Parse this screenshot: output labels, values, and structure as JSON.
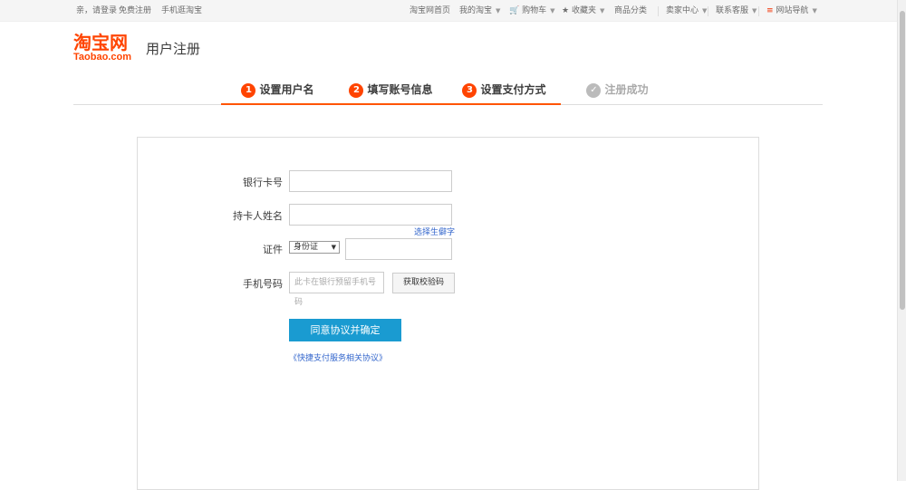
{
  "topbar": {
    "greeting": "亲，请登录",
    "register": "免费注册",
    "mobile": "手机逛淘宝",
    "home": "淘宝网首页",
    "my_taobao": "我的淘宝",
    "cart": "购物车",
    "favorites": "收藏夹",
    "categories": "商品分类",
    "seller_center": "卖家中心",
    "contact": "联系客服",
    "site_nav": "网站导航"
  },
  "header": {
    "logo_cn": "淘宝网",
    "logo_en": "Taobao.com",
    "title": "用户注册"
  },
  "steps": [
    {
      "num": "1",
      "label": "设置用户名",
      "state": "done"
    },
    {
      "num": "2",
      "label": "填写账号信息",
      "state": "done"
    },
    {
      "num": "3",
      "label": "设置支付方式",
      "state": "active"
    },
    {
      "num": "",
      "label": "注册成功",
      "state": "todo"
    }
  ],
  "form": {
    "card_label": "银行卡号",
    "card_value": "",
    "holder_label": "持卡人姓名",
    "holder_value": "",
    "rare_char_link": "选择生僻字",
    "id_label": "证件",
    "id_type": "身份证",
    "id_value": "",
    "phone_label": "手机号码",
    "phone_placeholder": "此卡在银行预留手机号码",
    "sms_button": "获取校验码",
    "submit_button": "同意协议并确定",
    "agreement_link": "《快捷支付服务相关协议》"
  }
}
